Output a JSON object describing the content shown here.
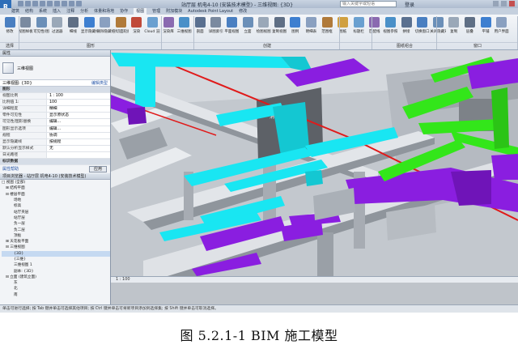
{
  "titlebar": {
    "title": "站厅层 机电4-10 (安装技术模型) - 三维视图: {3D}",
    "search_placeholder": "输入关键字或短语",
    "user": "登录"
  },
  "tabs": [
    "建筑",
    "结构",
    "系统",
    "插入",
    "注释",
    "分析",
    "体量和场地",
    "协作",
    "视图",
    "管理",
    "附加模块",
    "Autodesk Point Layout",
    "修改"
  ],
  "active_tab": "视图",
  "ribbon": {
    "buttons": [
      {
        "label": "修改",
        "color": "#4a7fc1"
      },
      {
        "label": "视图样板",
        "color": "#7a8aa0"
      },
      {
        "label": "可见性/图形",
        "color": "#6b8fb8"
      },
      {
        "label": "过滤器",
        "color": "#9aa8b8"
      },
      {
        "label": "细线",
        "color": "#5f6f85"
      },
      {
        "label": "显示隐藏线",
        "color": "#3e7fd0"
      },
      {
        "label": "删除隐藏线",
        "color": "#8aa0c0"
      },
      {
        "label": "剖切面轮廓",
        "color": "#b07a3a"
      },
      {
        "label": "渲染",
        "color": "#c04a3a"
      },
      {
        "label": "Cloud 渲染",
        "color": "#6aa0d0"
      },
      {
        "label": "渲染库",
        "color": "#8a6ab0"
      },
      {
        "label": "三维视图",
        "color": "#4a90c8"
      },
      {
        "label": "剖面",
        "color": "#5a7090"
      },
      {
        "label": "详图索引",
        "color": "#7a8aa0"
      },
      {
        "label": "平面视图",
        "color": "#4a7fc1"
      },
      {
        "label": "立面",
        "color": "#6b8fb8"
      },
      {
        "label": "绘图视图",
        "color": "#9aa8b8"
      },
      {
        "label": "复制视图",
        "color": "#5f6f85"
      },
      {
        "label": "图例",
        "color": "#3e7fd0"
      },
      {
        "label": "明细表",
        "color": "#8aa0c0"
      },
      {
        "label": "范围框",
        "color": "#b07a3a"
      },
      {
        "label": "图纸",
        "color": "#d0a040"
      },
      {
        "label": "标题栏",
        "color": "#6aa0d0"
      },
      {
        "label": "匹配线",
        "color": "#8a6ab0"
      },
      {
        "label": "视图参照",
        "color": "#4a90c8"
      },
      {
        "label": "拼接",
        "color": "#5a7090"
      },
      {
        "label": "切换窗口",
        "color": "#4a7fc1"
      },
      {
        "label": "关闭隐藏对象",
        "color": "#6b8fb8"
      },
      {
        "label": "复制",
        "color": "#9aa8b8"
      },
      {
        "label": "层叠",
        "color": "#5f6f85"
      },
      {
        "label": "平铺",
        "color": "#3e7fd0"
      },
      {
        "label": "用户界面",
        "color": "#8aa0c0"
      }
    ],
    "panels": [
      "选择",
      "图形",
      "",
      "创建",
      "",
      "图纸组合",
      "窗口"
    ]
  },
  "properties": {
    "header": "属性",
    "type_name": "三维视图",
    "view_selector": "三维视图: {3D}",
    "edit_type": "编辑类型",
    "rows": [
      {
        "k": "图形",
        "v": "",
        "section": true
      },
      {
        "k": "视图比例",
        "v": "1 : 100"
      },
      {
        "k": "比例值 1:",
        "v": "100"
      },
      {
        "k": "详细程度",
        "v": "精细"
      },
      {
        "k": "零件可见性",
        "v": "显示原状态"
      },
      {
        "k": "可见性/图形替换",
        "v": "编辑..."
      },
      {
        "k": "图形显示选项",
        "v": "编辑..."
      },
      {
        "k": "规程",
        "v": "协调"
      },
      {
        "k": "显示隐藏线",
        "v": "按规程"
      },
      {
        "k": "默认分析显示样式",
        "v": "无"
      },
      {
        "k": "日光路径",
        "v": ""
      },
      {
        "k": "标识数据",
        "v": "",
        "section": true
      }
    ],
    "apply_help": "属性帮助",
    "apply_button": "应用"
  },
  "browser": {
    "header": "项目浏览器 - 站厅层 机电4-10 (安装技术模型)",
    "nodes": [
      {
        "t": "□ 视图 (全部)",
        "d": 0
      },
      {
        "t": "⊞ 结构平面",
        "d": 1
      },
      {
        "t": "⊟ 楼层平面",
        "d": 1
      },
      {
        "t": "场地",
        "d": 3
      },
      {
        "t": "标高",
        "d": 3
      },
      {
        "t": "站厅夹层",
        "d": 3
      },
      {
        "t": "站厅层",
        "d": 3
      },
      {
        "t": "负一层",
        "d": 3
      },
      {
        "t": "负二层",
        "d": 3
      },
      {
        "t": "顶板",
        "d": 3
      },
      {
        "t": "⊞ 天花板平面",
        "d": 1
      },
      {
        "t": "⊟ 三维视图",
        "d": 1
      },
      {
        "t": "{3D}",
        "d": 3,
        "sel": true
      },
      {
        "t": "{三维}",
        "d": 3
      },
      {
        "t": "三维视图 1",
        "d": 3
      },
      {
        "t": "副本: {3D}",
        "d": 3
      },
      {
        "t": "⊟ 立面 (建筑立面)",
        "d": 1
      },
      {
        "t": "东",
        "d": 3
      },
      {
        "t": "北",
        "d": 3
      },
      {
        "t": "南",
        "d": 3
      }
    ]
  },
  "viewport": {
    "scale_label": "1 : 100",
    "room_label": "消防泵房"
  },
  "statusbar": {
    "text": "单击可进行选择; 按 Tab 键并单击可选择其他项目; 按 Ctrl 键并单击可将新项目添加到选择集; 按 Shift 键并单击可取消选择。"
  },
  "caption": "图 5.2.1-1 BIM 施工模型",
  "colors": {
    "duct_cyan": "#19e6f2",
    "duct_purple": "#8a1ee0",
    "pipe_green": "#33e61a",
    "pipe_red": "#e01a1a",
    "structure_gray": "#bfc3c9"
  }
}
